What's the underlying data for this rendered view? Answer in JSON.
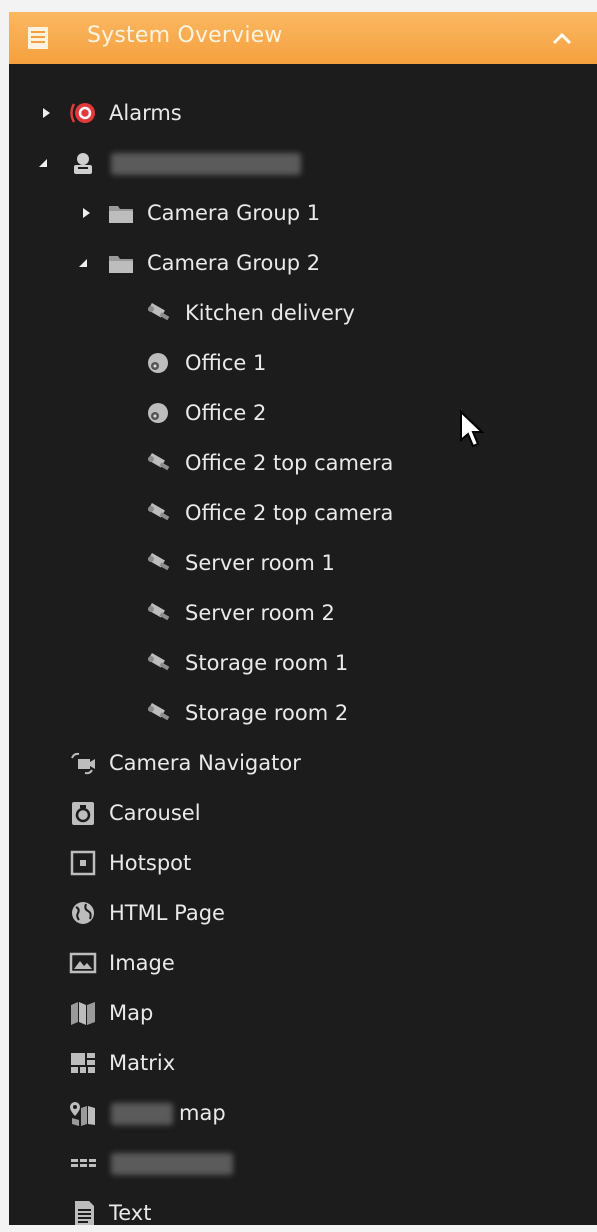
{
  "header": {
    "title": "System Overview"
  },
  "tree": {
    "alarms": "Alarms",
    "groups": [
      "Camera Group 1",
      "Camera Group 2"
    ],
    "cameras": [
      {
        "label": "Kitchen delivery",
        "icon": "ptz-camera-icon"
      },
      {
        "label": "Office 1",
        "icon": "dome-camera-icon"
      },
      {
        "label": "Office 2",
        "icon": "dome-camera-icon"
      },
      {
        "label": "Office 2 top camera",
        "icon": "ptz-camera-icon"
      },
      {
        "label": "Office 2 top camera",
        "icon": "ptz-camera-icon"
      },
      {
        "label": "Server room 1",
        "icon": "ptz-camera-icon"
      },
      {
        "label": "Server room 2",
        "icon": "ptz-camera-icon"
      },
      {
        "label": "Storage room 1",
        "icon": "ptz-camera-icon"
      },
      {
        "label": "Storage room 2",
        "icon": "ptz-camera-icon"
      }
    ],
    "items": [
      {
        "label": "Camera Navigator",
        "icon": "camera-navigator-icon"
      },
      {
        "label": "Carousel",
        "icon": "carousel-icon"
      },
      {
        "label": "Hotspot",
        "icon": "hotspot-icon"
      },
      {
        "label": "HTML Page",
        "icon": "globe-icon"
      },
      {
        "label": "Image",
        "icon": "image-icon"
      },
      {
        "label": "Map",
        "icon": "map-icon"
      },
      {
        "label": "Matrix",
        "icon": "matrix-icon"
      },
      {
        "label": "map",
        "icon": "smart-map-icon"
      },
      {
        "label": "",
        "icon": "grid-icon"
      },
      {
        "label": "Text",
        "icon": "text-icon"
      }
    ]
  },
  "colors": {
    "header": "#f5a03e",
    "panel": "#1c1c1c",
    "text": "#e9e9e9",
    "alarm": "#e23a3a"
  }
}
